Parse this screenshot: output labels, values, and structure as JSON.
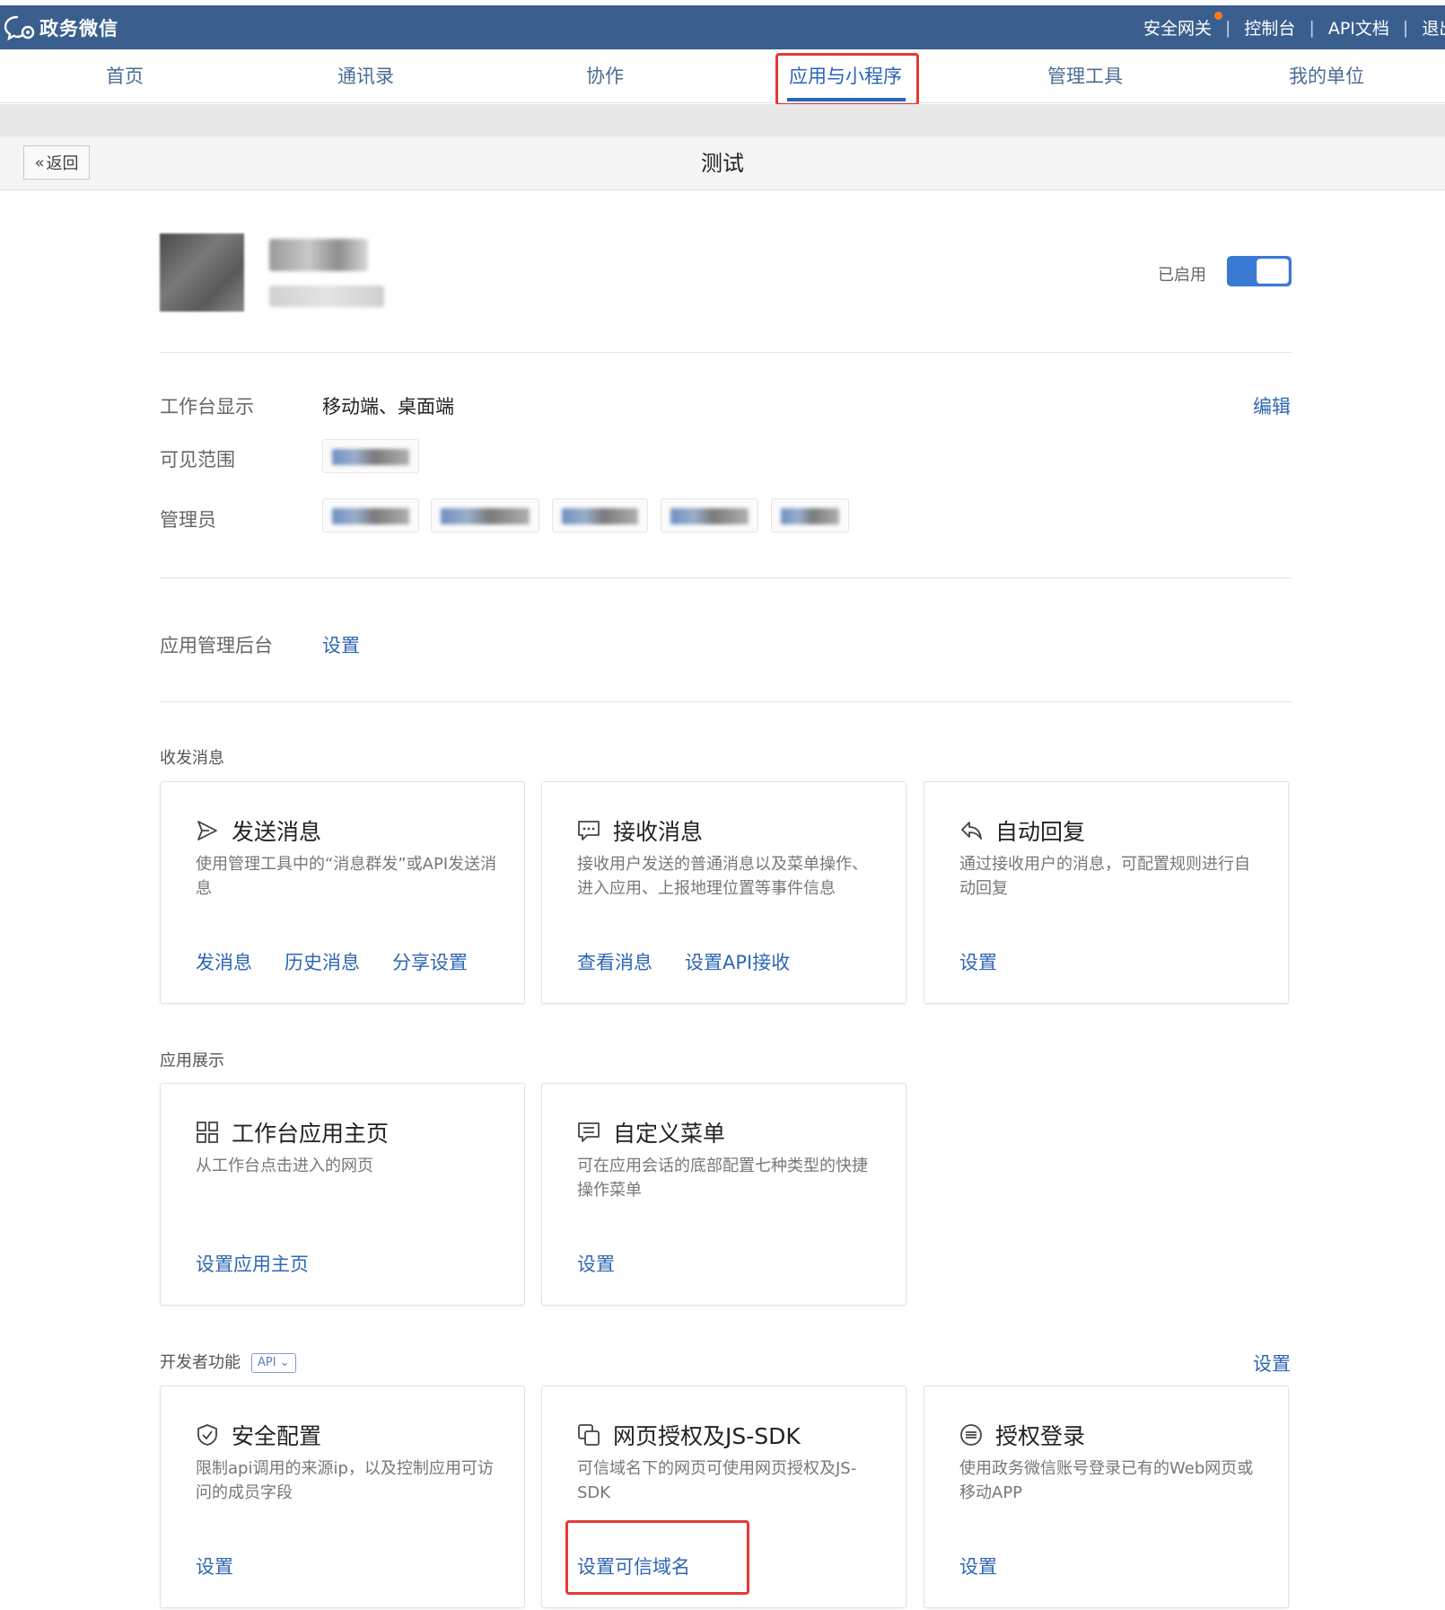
{
  "brand": {
    "name": "政务微信",
    "icon": "cloud-chat-icon"
  },
  "top_links": [
    "安全网关",
    "控制台",
    "API文档",
    "退出"
  ],
  "nav": {
    "tabs": [
      "首页",
      "通讯录",
      "协作",
      "应用与小程序",
      "管理工具",
      "我的单位"
    ],
    "active": "应用与小程序"
  },
  "back_label": "返回",
  "page_title": "测试",
  "app": {
    "status_label": "已启用",
    "enabled": true
  },
  "info": {
    "workbench_label": "工作台显示",
    "workbench_value": "移动端、桌面端",
    "edit_label": "编辑",
    "visible_label": "可见范围",
    "admin_label": "管理员"
  },
  "backend": {
    "label": "应用管理后台",
    "link": "设置"
  },
  "sections": {
    "messages": {
      "title": "收发消息",
      "cards": [
        {
          "icon": "send-icon",
          "title": "发送消息",
          "desc": "使用管理工具中的“消息群发”或API发送消息",
          "links": [
            "发消息",
            "历史消息",
            "分享设置"
          ]
        },
        {
          "icon": "chat-bubble-icon",
          "title": "接收消息",
          "desc": "接收用户发送的普通消息以及菜单操作、进入应用、上报地理位置等事件信息",
          "links": [
            "查看消息",
            "设置API接收"
          ]
        },
        {
          "icon": "reply-icon",
          "title": "自动回复",
          "desc": "通过接收用户的消息，可配置规则进行自动回复",
          "links": [
            "设置"
          ]
        }
      ]
    },
    "display": {
      "title": "应用展示",
      "cards": [
        {
          "icon": "grid-icon",
          "title": "工作台应用主页",
          "desc": "从工作台点击进入的网页",
          "links": [
            "设置应用主页"
          ]
        },
        {
          "icon": "menu-icon",
          "title": "自定义菜单",
          "desc": "可在应用会话的底部配置七种类型的快捷操作菜单",
          "links": [
            "设置"
          ]
        }
      ]
    },
    "developer": {
      "title": "开发者功能",
      "badge": "API",
      "link": "设置",
      "cards": [
        {
          "icon": "shield-check-icon",
          "title": "安全配置",
          "desc": "限制api调用的来源ip，以及控制应用可访问的成员字段",
          "links": [
            "设置"
          ]
        },
        {
          "icon": "copy-window-icon",
          "title": "网页授权及JS-SDK",
          "desc": "可信域名下的网页可使用网页授权及JS-SDK",
          "links": [
            "设置可信域名"
          ]
        },
        {
          "icon": "login-circle-icon",
          "title": "授权登录",
          "desc": "使用政务微信账号登录已有的Web网页或移动APP",
          "links": [
            "设置"
          ]
        }
      ]
    }
  },
  "colors": {
    "topbar": "#3a5f8f",
    "link": "#2f66b3",
    "toggle": "#3a7ad4",
    "highlight": "#e53935"
  }
}
